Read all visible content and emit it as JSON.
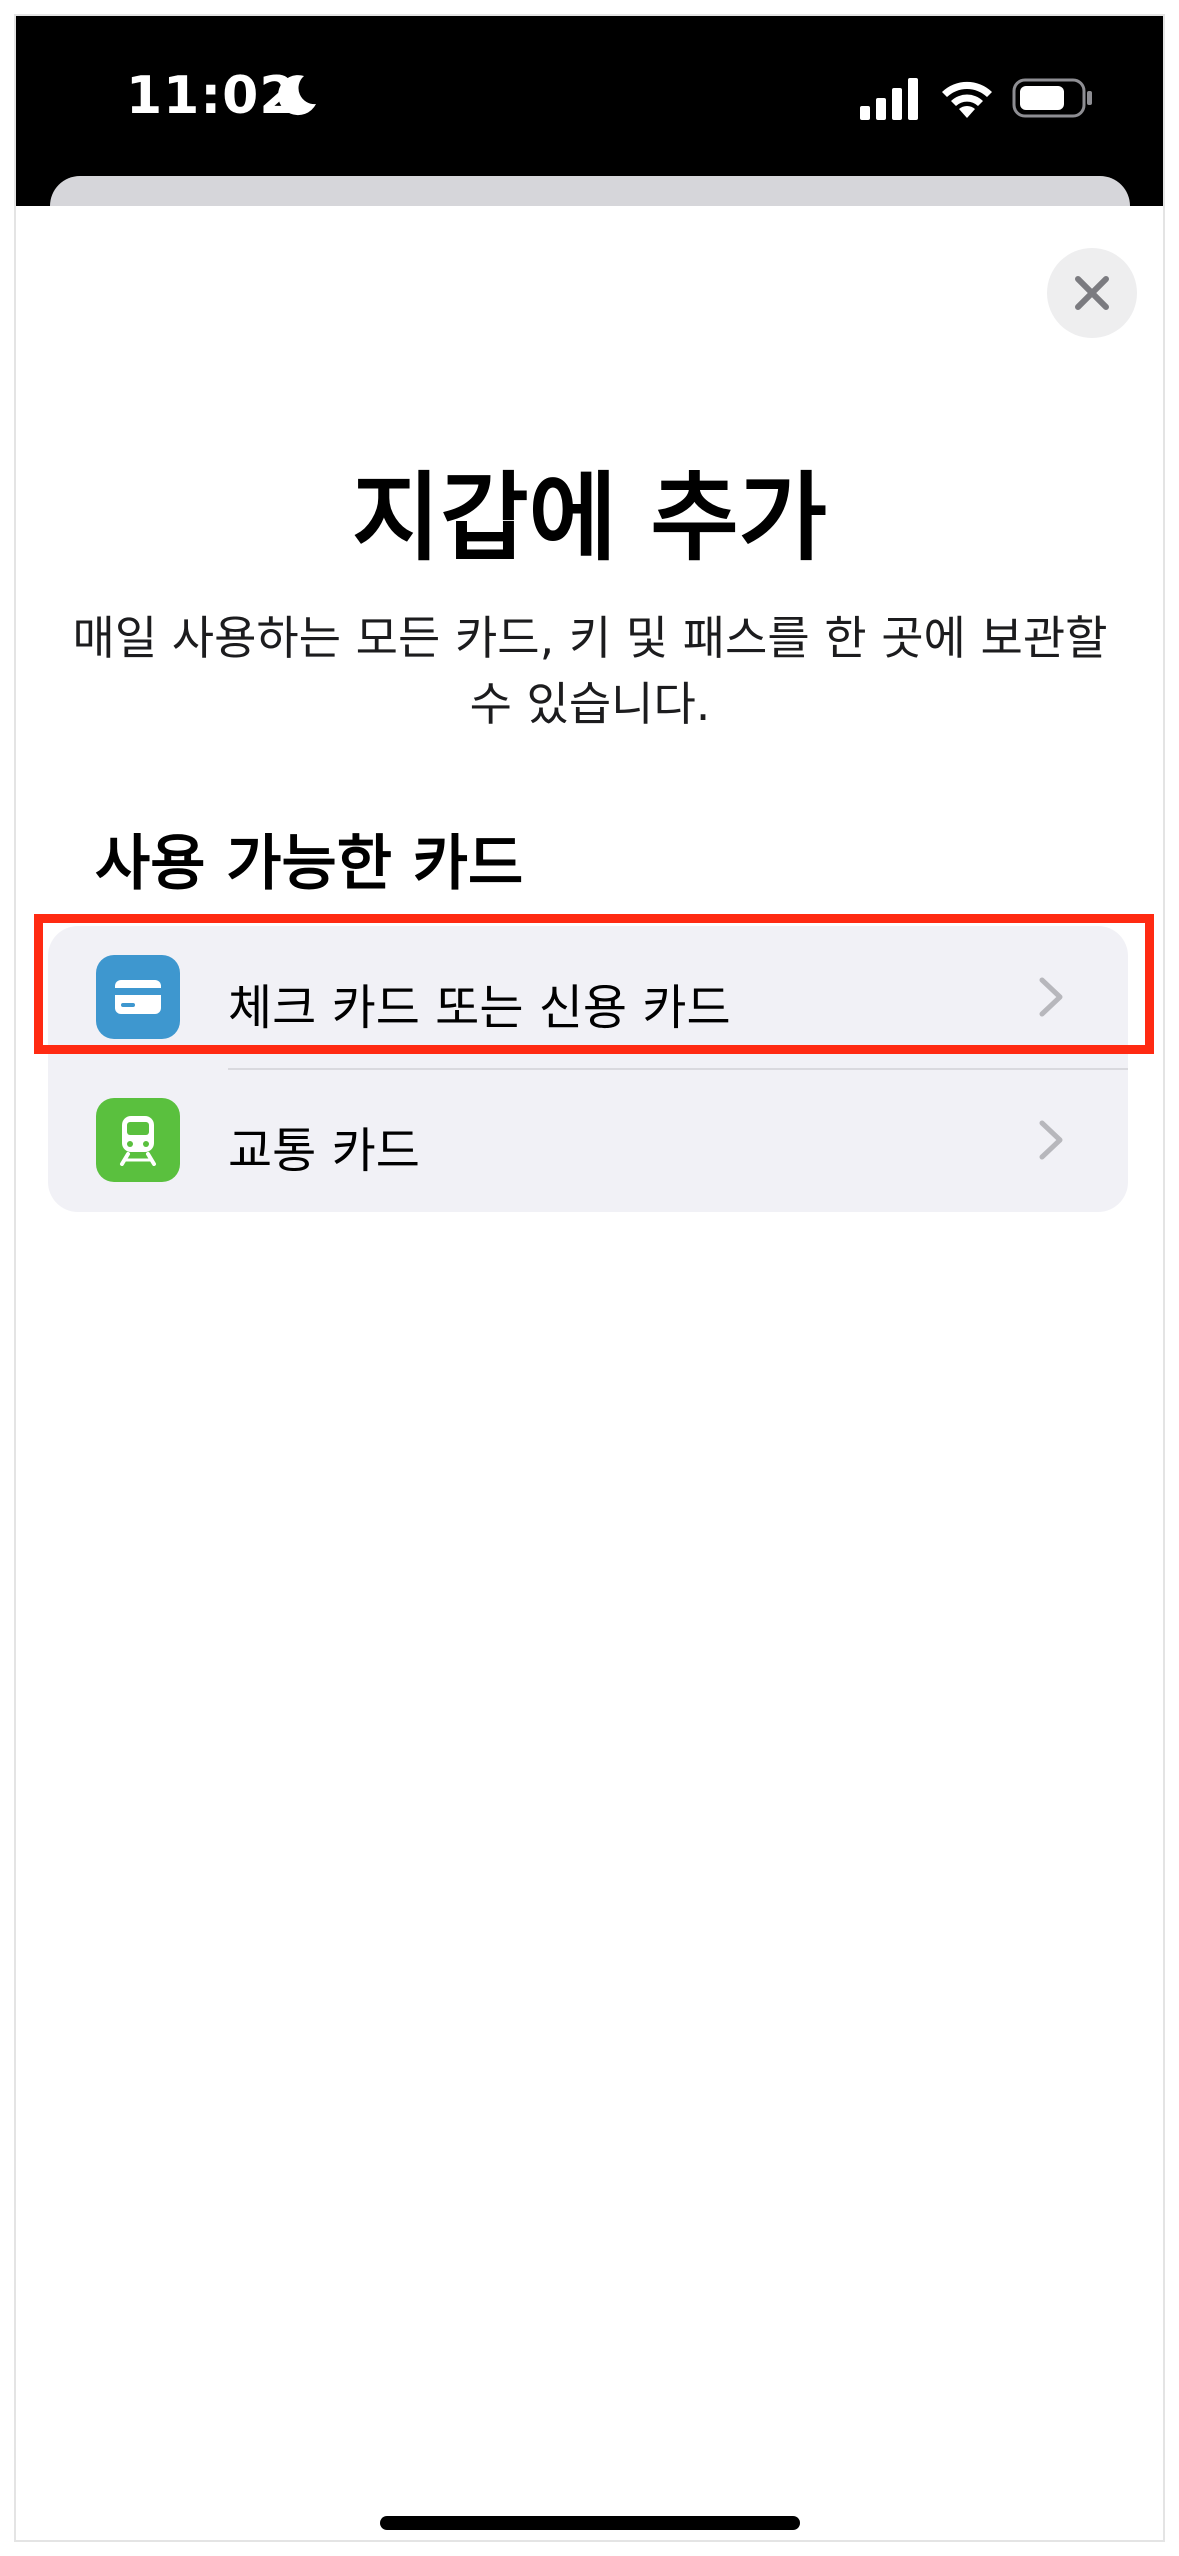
{
  "status_bar": {
    "time": "11:02",
    "icons": [
      "moon-icon",
      "cellular-signal-icon",
      "wifi-icon",
      "battery-icon"
    ]
  },
  "sheet": {
    "close_icon": "close-icon",
    "title": "지갑에 추가",
    "subtitle": "매일 사용하는 모든 카드, 키 및 패스를 한 곳에 보관할 수 있습니다.",
    "section_heading": "사용 가능한 카드",
    "items": [
      {
        "label": "체크 카드 또는 신용 카드",
        "icon": "credit-card-icon",
        "icon_color": "#3e97cf",
        "highlighted": true
      },
      {
        "label": "교통 카드",
        "icon": "train-icon",
        "icon_color": "#5ac03e",
        "highlighted": false
      }
    ]
  },
  "colors": {
    "highlight": "#ff2a12",
    "list_background": "#f1f1f6",
    "close_button_background": "#eeeeef"
  }
}
